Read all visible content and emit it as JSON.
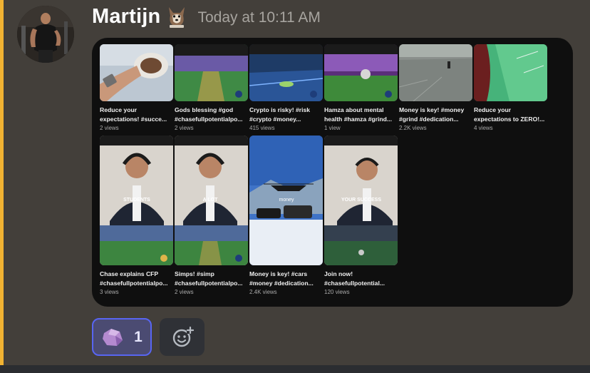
{
  "message": {
    "username": "Martijn",
    "timestamp": "Today at 10:11 AM"
  },
  "embed": {
    "videos": [
      {
        "title": "Reduce your\nexpectations! #succe...",
        "views": "2 views"
      },
      {
        "title": "Gods blessing #god\n#chasefullpotentialpo...",
        "views": "2 views"
      },
      {
        "title": "Crypto is risky! #risk\n#crypto #money...",
        "views": "415 views"
      },
      {
        "title": "Hamza about mental\nhealth #hamza #grind...",
        "views": "1 view"
      },
      {
        "title": "Money is key! #money\n#grind #dedication...",
        "views": "2.2K views"
      },
      {
        "title": "Reduce your\nexpectations to ZERO!...",
        "views": "4 views"
      },
      {
        "title": "Chase explains CFP\n#chasefullpotentialpo...",
        "views": "3 views",
        "caption": "STUDENTS"
      },
      {
        "title": "Simps! #simp\n#chasefullpotentialpo...",
        "views": "2 views",
        "caption": "A LOT"
      },
      {
        "title": "Money is key! #cars\n#money #dedication...",
        "views": "2.4K views",
        "caption": "money"
      },
      {
        "title": "Join now!\n#chasefullpotential...",
        "views": "120 views",
        "caption": "YOUR SUCCESS"
      }
    ]
  },
  "reactions": {
    "items": [
      {
        "emoji": "purple-rock-emoji",
        "count": "1"
      }
    ],
    "add_icon": "add-reaction-icon"
  },
  "colors": {
    "background": "#433f3a",
    "embed": "#0f0f0f",
    "accent": "#5865f2",
    "highlight_bar": "#f0b232"
  }
}
